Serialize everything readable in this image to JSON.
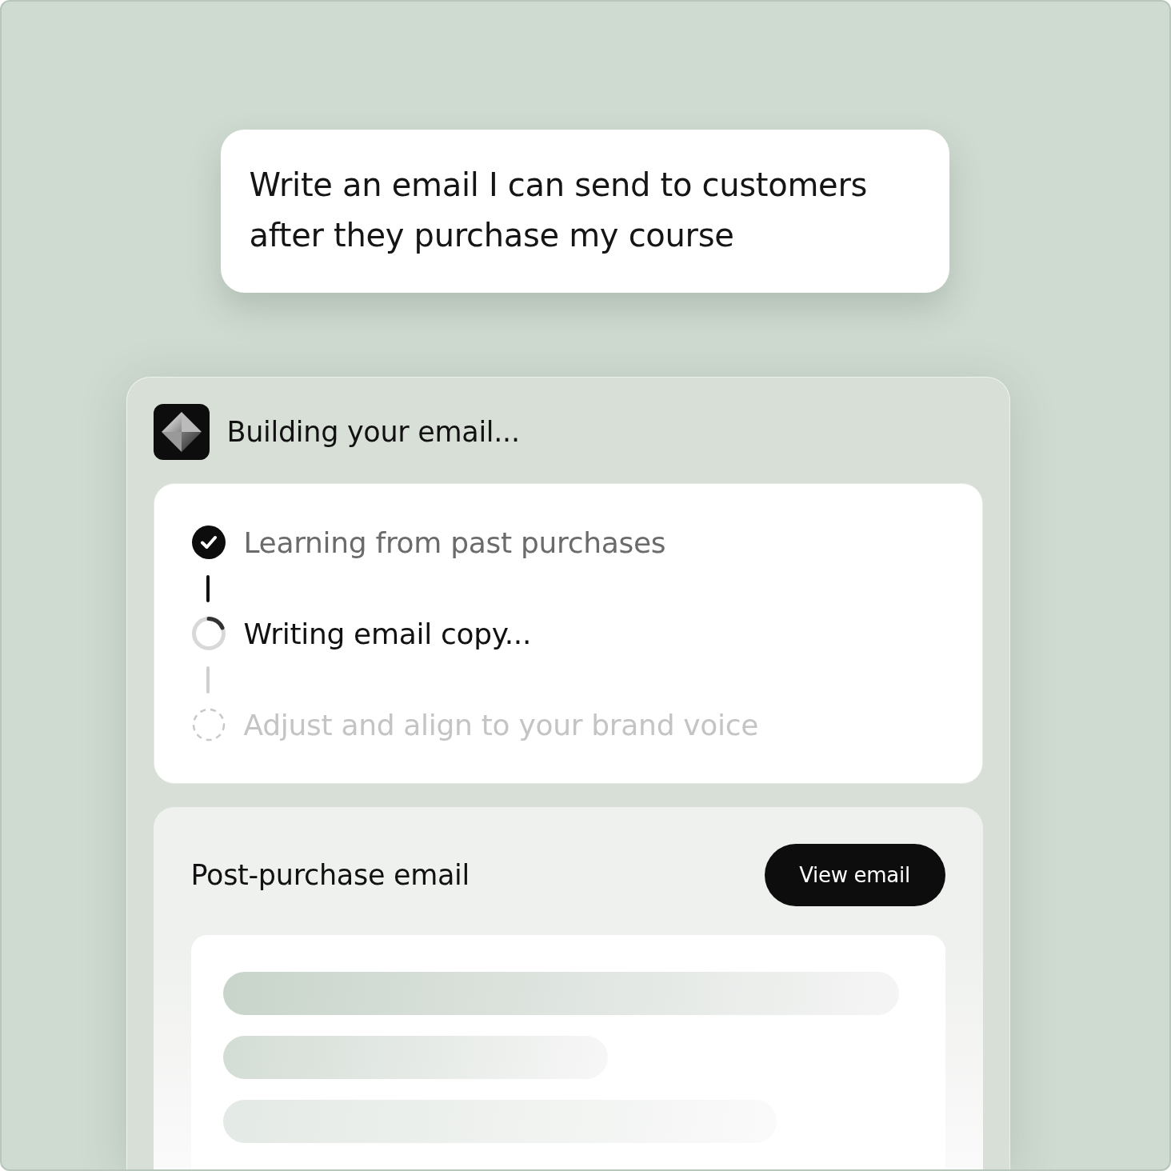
{
  "prompt": {
    "text": "Write an email I can send to customers after they purchase my course"
  },
  "progress": {
    "title": "Building your email...",
    "steps": [
      {
        "label": "Learning from past purchases",
        "kind": "done"
      },
      {
        "label": "Writing email copy...",
        "kind": "active"
      },
      {
        "label": "Adjust and align to your brand voice",
        "kind": "pending"
      }
    ]
  },
  "email_preview": {
    "title": "Post-purchase email",
    "button": "View email"
  }
}
